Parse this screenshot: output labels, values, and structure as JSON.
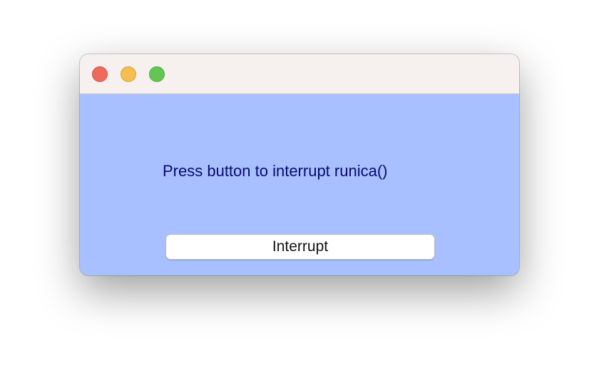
{
  "window": {
    "controls": {
      "close_icon": "close-icon",
      "minimize_icon": "minimize-icon",
      "zoom_icon": "zoom-icon"
    },
    "colors": {
      "titlebar": "#f6f1ef",
      "content_background": "#a8c0ff",
      "prompt_text": "#0a0a6e",
      "close": "#ee6a5f",
      "minimize": "#f5be4f",
      "zoom": "#62c554"
    }
  },
  "main": {
    "prompt": "Press button to interrupt runica()",
    "interrupt_button_label": "Interrupt"
  }
}
